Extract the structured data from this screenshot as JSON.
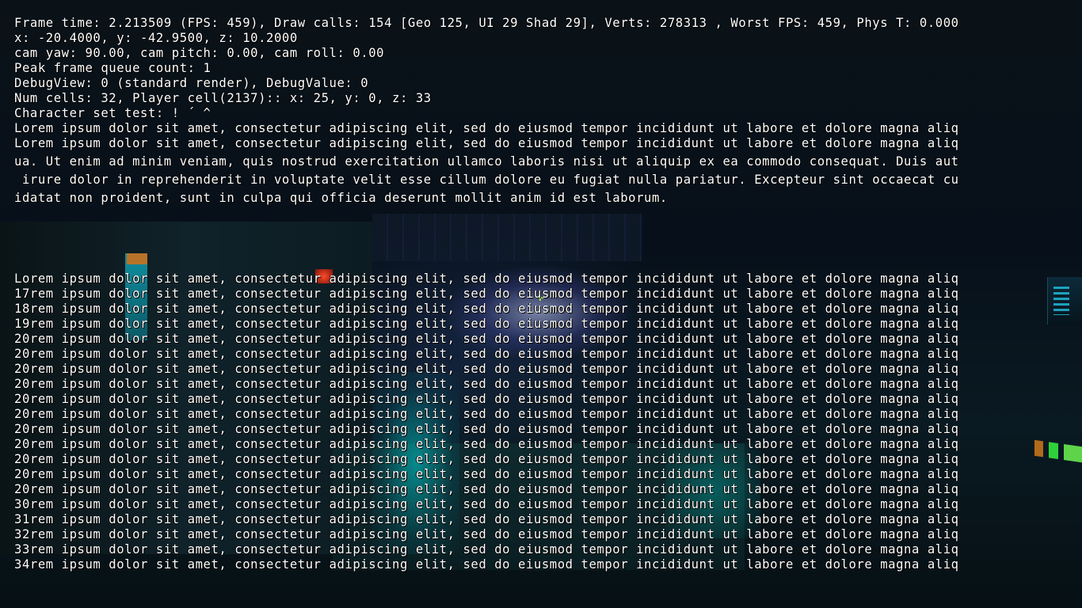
{
  "debug": {
    "frame_time": "Frame time: 2.213509 (FPS: 459), Draw calls: 154 [Geo 125, UI 29 Shad 29], Verts: 278313 , Worst FPS: 459, Phys T: 0.000",
    "position": "x: -20.4000, y: -42.9500, z: 10.2000",
    "camera": "cam yaw: 90.00, cam pitch: 0.00, cam roll: 0.00",
    "frame_queue": "Peak frame queue count: 1",
    "debug_view": "DebugView: 0 (standard render), DebugValue: 0",
    "cells": "Num cells: 32, Player cell(2137):: x: 25, y: 0, z: 33",
    "charset": "Character set test: ! ´ ^"
  },
  "wrapped_text": {
    "line1": "Lorem ipsum dolor sit amet, consectetur adipiscing elit, sed do eiusmod tempor incididunt ut labore et dolore magna aliq",
    "line2": "Lorem ipsum dolor sit amet, consectetur adipiscing elit, sed do eiusmod tempor incididunt ut labore et dolore magna aliq",
    "line3": "ua. Ut enim ad minim veniam, quis nostrud exercitation ullamco laboris nisi ut aliquip ex ea commodo consequat. Duis aut",
    "line4": " irure dolor in reprehenderit in voluptate velit esse cillum dolore eu fugiat nulla pariatur. Excepteur sint occaecat cu",
    "line5": "idatat non proident, sunt in culpa qui officia deserunt mollit anim id est laborum."
  },
  "numbered_lines": [
    "Lorem ipsum dolor sit amet, consectetur adipiscing elit, sed do eiusmod tempor incididunt ut labore et dolore magna aliq",
    "17rem ipsum dolor sit amet, consectetur adipiscing elit, sed do eiusmod tempor incididunt ut labore et dolore magna aliq",
    "18rem ipsum dolor sit amet, consectetur adipiscing elit, sed do eiusmod tempor incididunt ut labore et dolore magna aliq",
    "19rem ipsum dolor sit amet, consectetur adipiscing elit, sed do eiusmod tempor incididunt ut labore et dolore magna aliq",
    "20rem ipsum dolor sit amet, consectetur adipiscing elit, sed do eiusmod tempor incididunt ut labore et dolore magna aliq",
    "20rem ipsum dolor sit amet, consectetur adipiscing elit, sed do eiusmod tempor incididunt ut labore et dolore magna aliq",
    "20rem ipsum dolor sit amet, consectetur adipiscing elit, sed do eiusmod tempor incididunt ut labore et dolore magna aliq",
    "20rem ipsum dolor sit amet, consectetur adipiscing elit, sed do eiusmod tempor incididunt ut labore et dolore magna aliq",
    "20rem ipsum dolor sit amet, consectetur adipiscing elit, sed do eiusmod tempor incididunt ut labore et dolore magna aliq",
    "20rem ipsum dolor sit amet, consectetur adipiscing elit, sed do eiusmod tempor incididunt ut labore et dolore magna aliq",
    "20rem ipsum dolor sit amet, consectetur adipiscing elit, sed do eiusmod tempor incididunt ut labore et dolore magna aliq",
    "20rem ipsum dolor sit amet, consectetur adipiscing elit, sed do eiusmod tempor incididunt ut labore et dolore magna aliq",
    "20rem ipsum dolor sit amet, consectetur adipiscing elit, sed do eiusmod tempor incididunt ut labore et dolore magna aliq",
    "20rem ipsum dolor sit amet, consectetur adipiscing elit, sed do eiusmod tempor incididunt ut labore et dolore magna aliq",
    "20rem ipsum dolor sit amet, consectetur adipiscing elit, sed do eiusmod tempor incididunt ut labore et dolore magna aliq",
    "30rem ipsum dolor sit amet, consectetur adipiscing elit, sed do eiusmod tempor incididunt ut labore et dolore magna aliq",
    "31rem ipsum dolor sit amet, consectetur adipiscing elit, sed do eiusmod tempor incididunt ut labore et dolore magna aliq",
    "32rem ipsum dolor sit amet, consectetur adipiscing elit, sed do eiusmod tempor incididunt ut labore et dolore magna aliq",
    "33rem ipsum dolor sit amet, consectetur adipiscing elit, sed do eiusmod tempor incididunt ut labore et dolore magna aliq",
    "34rem ipsum dolor sit amet, consectetur adipiscing elit, sed do eiusmod tempor incididunt ut labore et dolore magna aliq"
  ],
  "colors": {
    "hud_text": "#ffffff",
    "crosshair": "#9be04a",
    "scene_cyan": "#00dcdc"
  }
}
